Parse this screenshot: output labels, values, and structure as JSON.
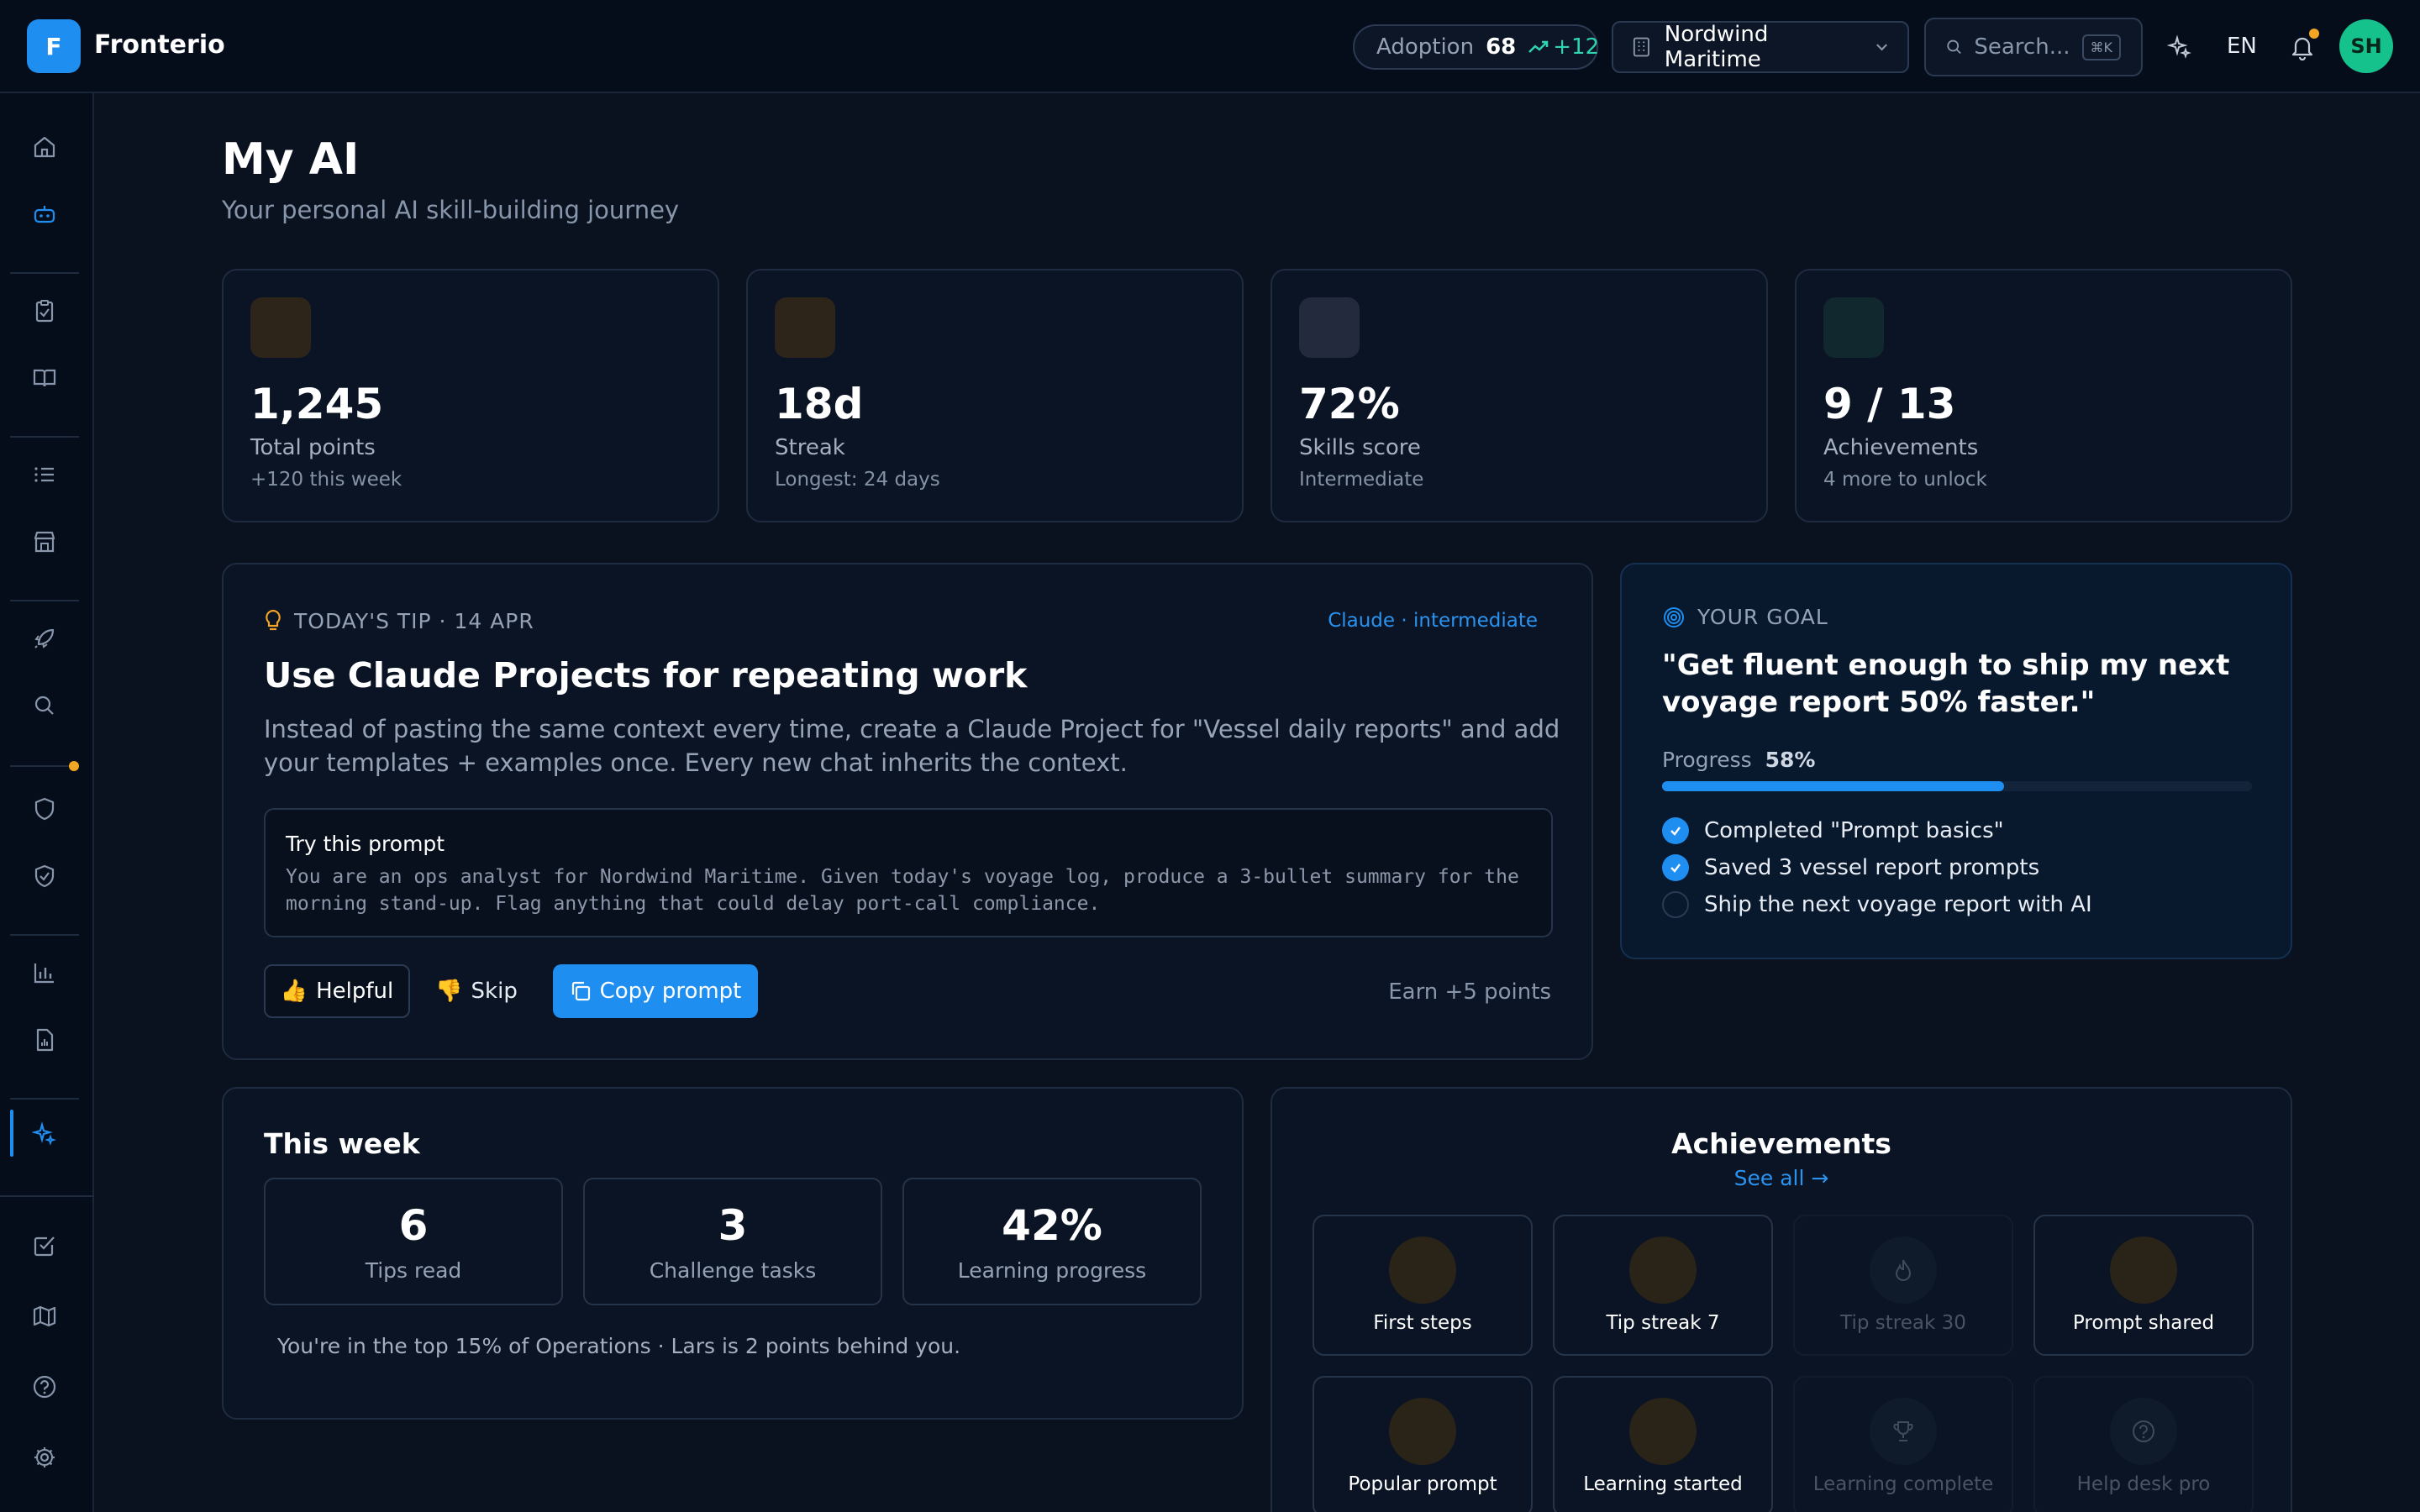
{
  "app": {
    "brand_initial": "F",
    "brand_name": "Fronterio"
  },
  "topbar": {
    "adoption_label": "Adoption",
    "adoption_value": "68",
    "adoption_delta": "+12",
    "org_name": "Nordwind Maritime",
    "search_placeholder": "Search...",
    "search_shortcut": "⌘K",
    "language": "EN",
    "avatar_initials": "SH"
  },
  "page": {
    "title": "My AI",
    "subtitle": "Your personal AI skill-building journey"
  },
  "stats": [
    {
      "value": "1,245",
      "label": "Total points",
      "sub": "+120 this week"
    },
    {
      "value": "18d",
      "label": "Streak",
      "sub": "Longest: 24 days"
    },
    {
      "value": "72%",
      "label": "Skills score",
      "sub": "Intermediate"
    },
    {
      "value": "9 / 13",
      "label": "Achievements",
      "sub": "4 more to unlock"
    }
  ],
  "tip": {
    "header": "TODAY'S TIP · 14 APR",
    "tag": "Claude · intermediate",
    "title": "Use Claude Projects for repeating work",
    "description": "Instead of pasting the same context every time, create a Claude Project for \"Vessel daily reports\" and add your templates + examples once. Every new chat inherits the context.",
    "prompt_label": "Try this prompt",
    "prompt_text": "You are an ops analyst for Nordwind Maritime. Given today's voyage log, produce a 3-bullet summary for the morning stand-up. Flag anything that could delay port-call compliance.",
    "helpful_label": "Helpful",
    "skip_label": "Skip",
    "copy_label": "Copy prompt",
    "earn_text": "Earn +5 points"
  },
  "goal": {
    "header": "YOUR GOAL",
    "quote": "\"Get fluent enough to ship my next voyage report 50% faster.\"",
    "progress_label": "Progress",
    "progress_value": "58%",
    "progress_fraction": 0.58,
    "items": [
      {
        "label": "Completed \"Prompt basics\"",
        "done": true
      },
      {
        "label": "Saved 3 vessel report prompts",
        "done": true
      },
      {
        "label": "Ship the next voyage report with AI",
        "done": false
      }
    ]
  },
  "week": {
    "title": "This week",
    "stats": [
      {
        "value": "6",
        "label": "Tips read"
      },
      {
        "value": "3",
        "label": "Challenge tasks"
      },
      {
        "value": "42%",
        "label": "Learning progress"
      }
    ],
    "note": "You're in the top 15% of Operations · Lars is 2 points behind you."
  },
  "achievements": {
    "title": "Achievements",
    "see_all": "See all →",
    "badges": [
      {
        "label": "First steps",
        "unlocked": true
      },
      {
        "label": "Tip streak 7",
        "unlocked": true
      },
      {
        "label": "Tip streak 30",
        "unlocked": false
      },
      {
        "label": "Prompt shared",
        "unlocked": true
      },
      {
        "label": "Popular prompt",
        "unlocked": true
      },
      {
        "label": "Learning started",
        "unlocked": true
      },
      {
        "label": "Learning complete",
        "unlocked": false
      },
      {
        "label": "Help desk pro",
        "unlocked": false
      }
    ]
  },
  "colors": {
    "accent": "#1f8ef1",
    "positive": "#2fd3b2",
    "warning": "#f5a524",
    "avatar": "#16c28c"
  }
}
